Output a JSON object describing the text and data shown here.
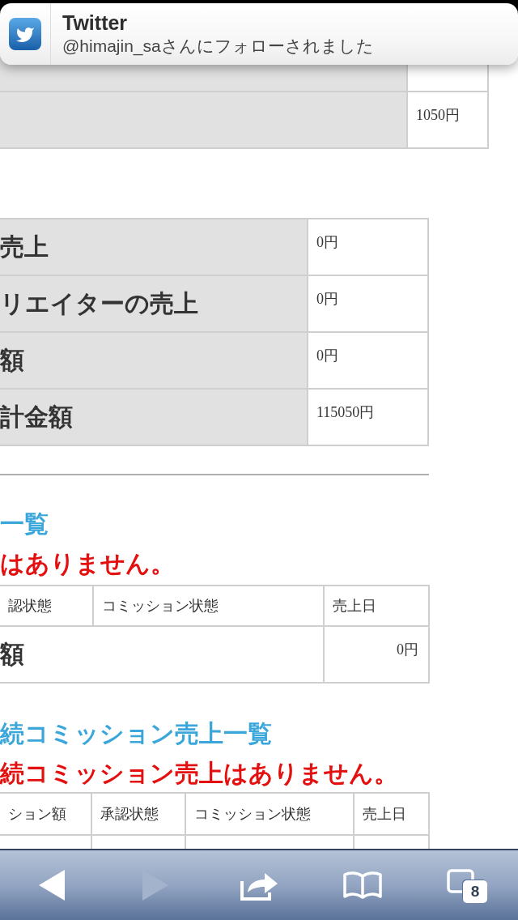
{
  "notification": {
    "app": "Twitter",
    "message": "@himajin_saさんにフォローされました"
  },
  "top_table": {
    "rows": [
      {
        "value": "1050円"
      }
    ]
  },
  "summary_table": {
    "rows": [
      {
        "label": "売上",
        "value": "0円"
      },
      {
        "label": "リエイターの売上",
        "value": "0円"
      },
      {
        "label": "額",
        "value": "0円"
      },
      {
        "label": "計金額",
        "value": "115050円"
      }
    ]
  },
  "sections": [
    {
      "heading": "一覧",
      "notice": "はありません。",
      "columns": [
        "認状態",
        "コミッション状態",
        "売上日"
      ],
      "total": {
        "label": "額",
        "value": "0円"
      }
    },
    {
      "heading": "続コミッション売上一覧",
      "notice": "続コミッション売上はありません。",
      "columns": [
        "ション額",
        "承認状態",
        "コミッション状態",
        "売上日"
      ]
    }
  ],
  "toolbar": {
    "buttons": [
      {
        "kind": "back",
        "disabled": false
      },
      {
        "kind": "forward",
        "disabled": true
      },
      {
        "kind": "share",
        "disabled": false
      },
      {
        "kind": "bookmarks",
        "disabled": false
      },
      {
        "kind": "tabs",
        "disabled": false,
        "count": "8"
      }
    ]
  }
}
